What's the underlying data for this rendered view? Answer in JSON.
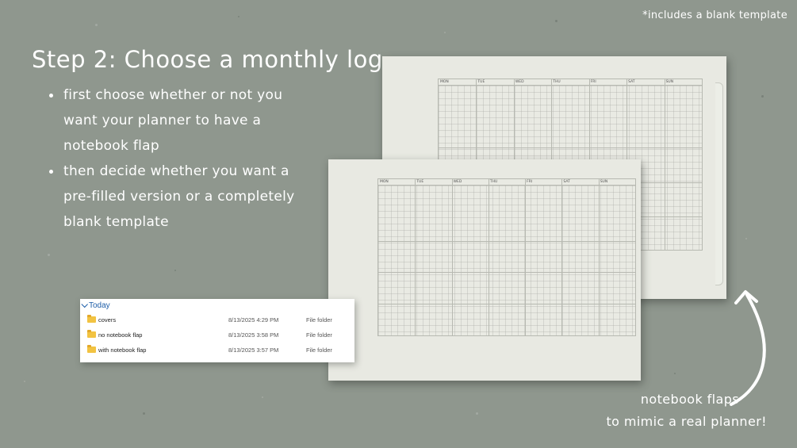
{
  "corner_note": "*includes a blank template",
  "title": "Step 2: Choose a monthly log",
  "bullets": [
    "first choose whether or not you want your planner to have a notebook flap",
    "then decide whether you want a pre-filled version or a completely blank template"
  ],
  "planner": {
    "days": [
      "MON",
      "TUE",
      "WED",
      "THU",
      "FRI",
      "SAT",
      "SUN"
    ]
  },
  "explorer": {
    "group": "Today",
    "rows": [
      {
        "name": "covers",
        "date": "8/13/2025 4:29 PM",
        "type": "File folder"
      },
      {
        "name": "no notebook flap",
        "date": "8/13/2025 3:58 PM",
        "type": "File folder"
      },
      {
        "name": "with notebook flap",
        "date": "8/13/2025 3:57 PM",
        "type": "File folder"
      }
    ]
  },
  "flaps_caption": {
    "line1": "notebook flaps",
    "line2": "to mimic a real planner!"
  },
  "colors": {
    "background": "#8f978e",
    "paper": "#e8e9e2",
    "folder": "#f2c342",
    "group_header": "#1e5ea8"
  },
  "icons": [
    "folder-icon",
    "chevron-down-icon",
    "curved-arrow-icon"
  ]
}
